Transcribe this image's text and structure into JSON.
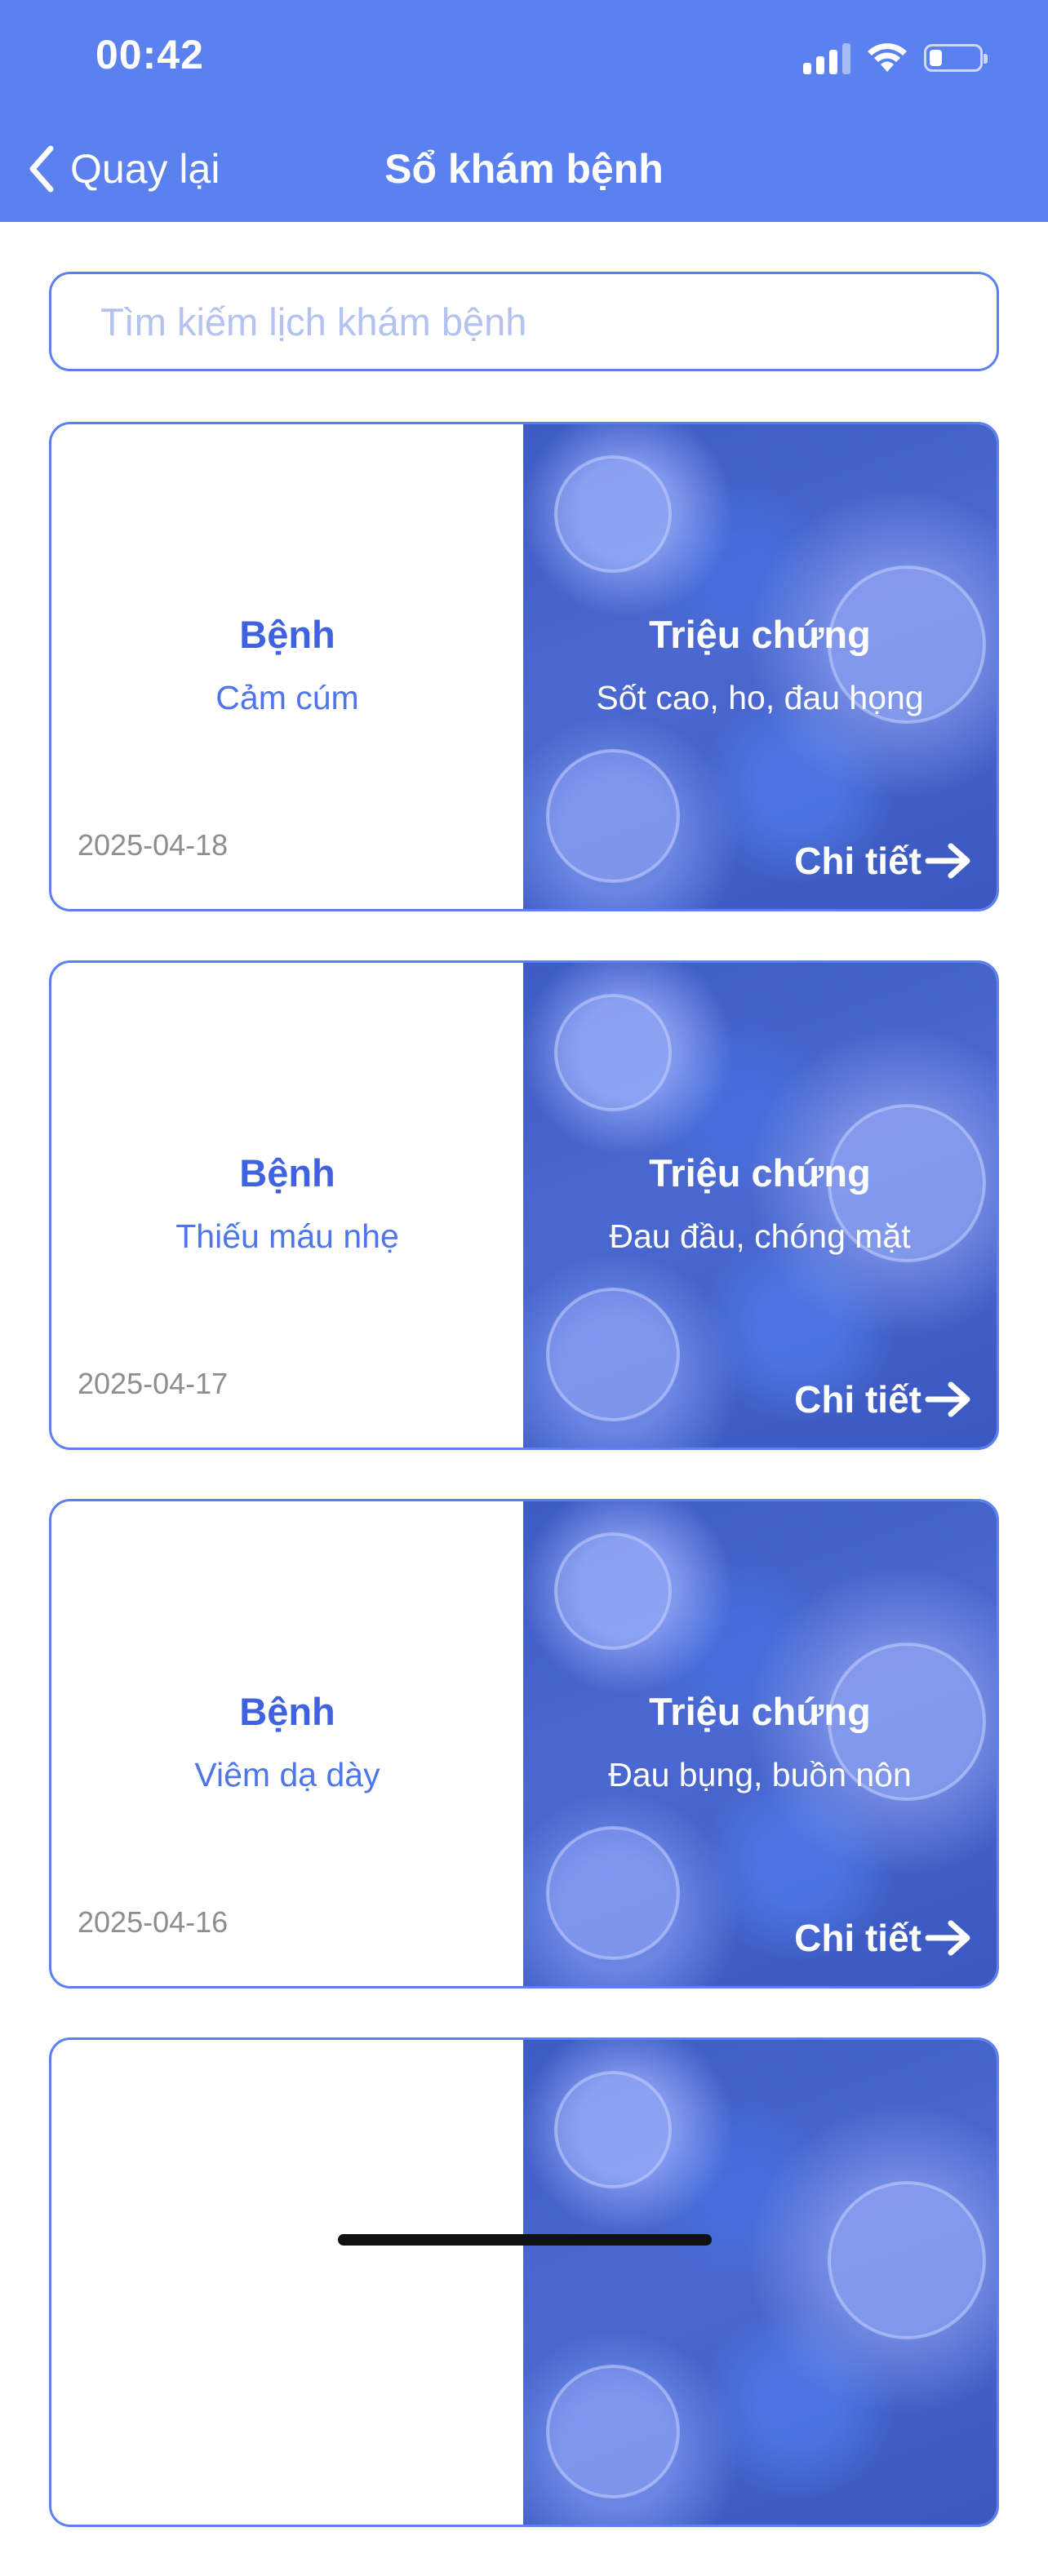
{
  "status_bar": {
    "time": "00:42",
    "icons": [
      "cellular-signal-icon",
      "wifi-icon",
      "battery-icon"
    ],
    "battery_level": 0.25
  },
  "nav": {
    "back_label": "Quay lại",
    "title": "Sổ khám bệnh"
  },
  "search": {
    "placeholder": "Tìm kiếm lịch khám bệnh",
    "value": ""
  },
  "records": [
    {
      "disease_label": "Bệnh",
      "disease": "Cảm cúm",
      "date": "2025-04-18",
      "symptoms_label": "Triệu chứng",
      "symptoms": "Sốt cao, ho, đau họng",
      "detail_label": "Chi tiết"
    },
    {
      "disease_label": "Bệnh",
      "disease": "Thiếu máu nhẹ",
      "date": "2025-04-17",
      "symptoms_label": "Triệu chứng",
      "symptoms": "Đau đầu, chóng mặt",
      "detail_label": "Chi tiết"
    },
    {
      "disease_label": "Bệnh",
      "disease": "Viêm dạ dày",
      "date": "2025-04-16",
      "symptoms_label": "Triệu chứng",
      "symptoms": "Đau bụng, buồn nôn",
      "detail_label": "Chi tiết"
    },
    {
      "disease_label": "",
      "disease": "",
      "date": "",
      "symptoms_label": "",
      "symptoms": "",
      "detail_label": ""
    }
  ],
  "colors": {
    "primary": "#5b80ef",
    "card_text": "#3f63e0",
    "date_text": "#8e8e8e",
    "placeholder": "#b3c2ee"
  }
}
